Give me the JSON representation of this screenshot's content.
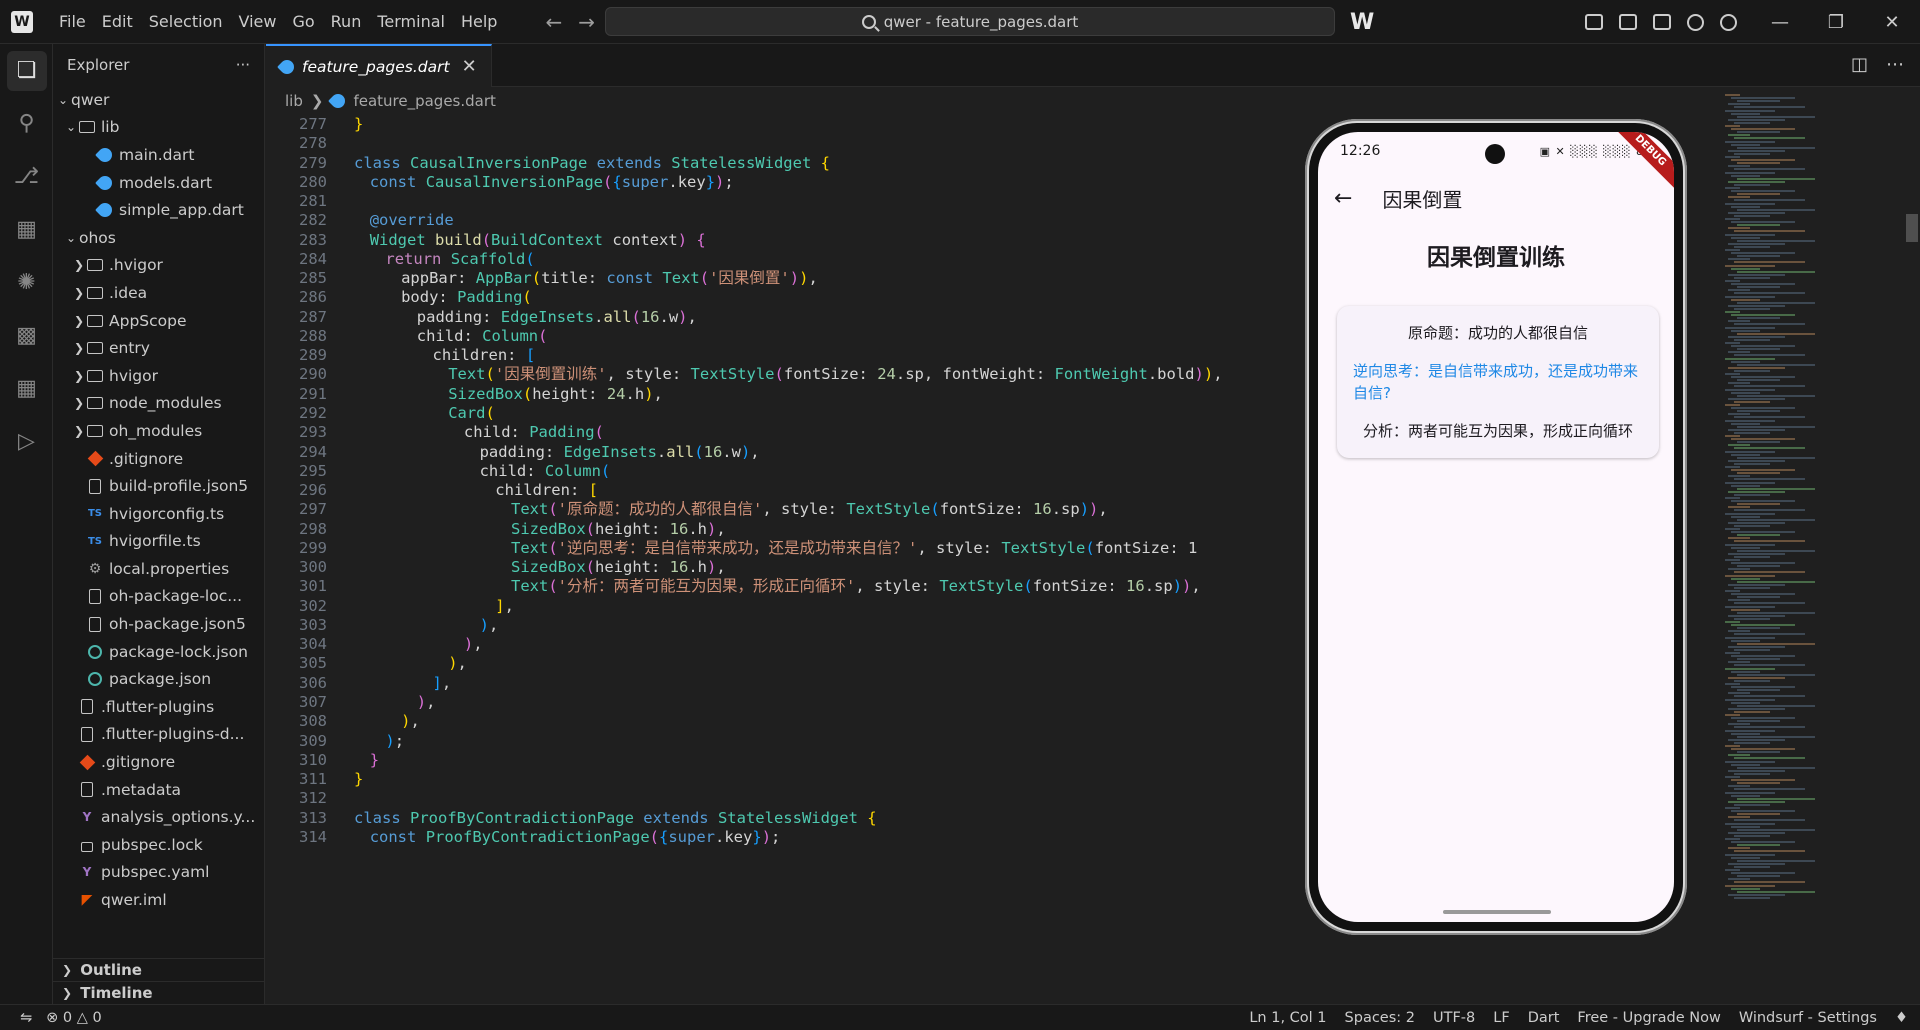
{
  "menu": [
    "File",
    "Edit",
    "Selection",
    "View",
    "Go",
    "Run",
    "Terminal",
    "Help"
  ],
  "command_center": "qwer - feature_pages.dart",
  "sidebar": {
    "title": "Explorer",
    "more": "···",
    "root": "qwer",
    "lib_folder": "lib",
    "lib_files": [
      "main.dart",
      "models.dart",
      "simple_app.dart"
    ],
    "ohos_folder": "ohos",
    "ohos_items": [
      {
        "label": ".hvigor",
        "type": "folder"
      },
      {
        "label": ".idea",
        "type": "folder"
      },
      {
        "label": "AppScope",
        "type": "folder"
      },
      {
        "label": "entry",
        "type": "folder"
      },
      {
        "label": "hvigor",
        "type": "folder"
      },
      {
        "label": "node_modules",
        "type": "folder"
      },
      {
        "label": "oh_modules",
        "type": "folder"
      },
      {
        "label": ".gitignore",
        "type": "git"
      },
      {
        "label": "build-profile.json5",
        "type": "file"
      },
      {
        "label": "hvigorconfig.ts",
        "type": "ts"
      },
      {
        "label": "hvigorfile.ts",
        "type": "ts"
      },
      {
        "label": "local.properties",
        "type": "gear"
      },
      {
        "label": "oh-package-loc...",
        "type": "file"
      },
      {
        "label": "oh-package.json5",
        "type": "file"
      },
      {
        "label": "package-lock.json",
        "type": "json"
      },
      {
        "label": "package.json",
        "type": "json"
      }
    ],
    "root_items": [
      {
        "label": ".flutter-plugins",
        "type": "file"
      },
      {
        "label": ".flutter-plugins-d...",
        "type": "file"
      },
      {
        "label": ".gitignore",
        "type": "git"
      },
      {
        "label": ".metadata",
        "type": "file"
      },
      {
        "label": "analysis_options.y...",
        "type": "yaml"
      },
      {
        "label": "pubspec.lock",
        "type": "lock"
      },
      {
        "label": "pubspec.yaml",
        "type": "yaml"
      },
      {
        "label": "qwer.iml",
        "type": "rss"
      }
    ],
    "outline": "Outline",
    "timeline": "Timeline"
  },
  "tab": {
    "label": "feature_pages.dart",
    "close": "✕"
  },
  "breadcrumb": {
    "folder": "lib",
    "file": "feature_pages.dart"
  },
  "code_lines": [
    {
      "n": "277",
      "indent": 0,
      "tokens": [
        [
          "br1",
          "}"
        ]
      ]
    },
    {
      "n": "278",
      "indent": 0,
      "tokens": []
    },
    {
      "n": "279",
      "indent": 0,
      "tokens": [
        [
          "kw",
          "class "
        ],
        [
          "cls",
          "CausalInversionPage "
        ],
        [
          "kw",
          "extends "
        ],
        [
          "cls",
          "StatelessWidget "
        ],
        [
          "br1",
          "{"
        ]
      ]
    },
    {
      "n": "280",
      "indent": 1,
      "tokens": [
        [
          "kw",
          "const "
        ],
        [
          "cls",
          "CausalInversionPage"
        ],
        [
          "br2",
          "("
        ],
        [
          "br3",
          "{"
        ],
        [
          "kw",
          "super"
        ],
        [
          "prop",
          ".key"
        ],
        [
          "br3",
          "}"
        ],
        [
          "br2",
          ")"
        ],
        [
          "prop",
          ";"
        ]
      ]
    },
    {
      "n": "281",
      "indent": 0,
      "tokens": []
    },
    {
      "n": "282",
      "indent": 1,
      "tokens": [
        [
          "ann",
          "@override"
        ]
      ]
    },
    {
      "n": "283",
      "indent": 1,
      "tokens": [
        [
          "cls",
          "Widget "
        ],
        [
          "fn",
          "build"
        ],
        [
          "br2",
          "("
        ],
        [
          "cls",
          "BuildContext "
        ],
        [
          "prop",
          "context"
        ],
        [
          "br2",
          ") "
        ],
        [
          "br2",
          "{"
        ]
      ]
    },
    {
      "n": "284",
      "indent": 2,
      "tokens": [
        [
          "ctrl",
          "return "
        ],
        [
          "cls",
          "Scaffold"
        ],
        [
          "br3",
          "("
        ]
      ]
    },
    {
      "n": "285",
      "indent": 3,
      "tokens": [
        [
          "prop",
          "appBar: "
        ],
        [
          "cls",
          "AppBar"
        ],
        [
          "br1",
          "("
        ],
        [
          "prop",
          "title: "
        ],
        [
          "kw",
          "const "
        ],
        [
          "cls",
          "Text"
        ],
        [
          "br2",
          "("
        ],
        [
          "str",
          "'因果倒置'"
        ],
        [
          "br2",
          ")"
        ],
        [
          "br1",
          ")"
        ],
        [
          "prop",
          ","
        ]
      ]
    },
    {
      "n": "286",
      "indent": 3,
      "tokens": [
        [
          "prop",
          "body: "
        ],
        [
          "cls",
          "Padding"
        ],
        [
          "br1",
          "("
        ]
      ]
    },
    {
      "n": "287",
      "indent": 4,
      "tokens": [
        [
          "prop",
          "padding: "
        ],
        [
          "cls",
          "EdgeInsets"
        ],
        [
          "prop",
          "."
        ],
        [
          "fn",
          "all"
        ],
        [
          "br2",
          "("
        ],
        [
          "num",
          "16"
        ],
        [
          "prop",
          ".w"
        ],
        [
          "br2",
          ")"
        ],
        [
          "prop",
          ","
        ]
      ]
    },
    {
      "n": "288",
      "indent": 4,
      "tokens": [
        [
          "prop",
          "child: "
        ],
        [
          "cls",
          "Column"
        ],
        [
          "br2",
          "("
        ]
      ]
    },
    {
      "n": "289",
      "indent": 5,
      "tokens": [
        [
          "prop",
          "children: "
        ],
        [
          "br3",
          "["
        ]
      ]
    },
    {
      "n": "290",
      "indent": 6,
      "tokens": [
        [
          "cls",
          "Text"
        ],
        [
          "br1",
          "("
        ],
        [
          "str",
          "'因果倒置训练'"
        ],
        [
          "prop",
          ", style: "
        ],
        [
          "cls",
          "TextStyle"
        ],
        [
          "br2",
          "("
        ],
        [
          "prop",
          "fontSize: "
        ],
        [
          "num",
          "24"
        ],
        [
          "prop",
          ".sp, fontWeight: "
        ],
        [
          "cls",
          "FontWeight"
        ],
        [
          "prop",
          ".bold"
        ],
        [
          "br2",
          ")"
        ],
        [
          "br1",
          ")"
        ],
        [
          "prop",
          ","
        ]
      ]
    },
    {
      "n": "291",
      "indent": 6,
      "tokens": [
        [
          "cls",
          "SizedBox"
        ],
        [
          "br1",
          "("
        ],
        [
          "prop",
          "height: "
        ],
        [
          "num",
          "24"
        ],
        [
          "prop",
          ".h"
        ],
        [
          "br1",
          ")"
        ],
        [
          "prop",
          ","
        ]
      ]
    },
    {
      "n": "292",
      "indent": 6,
      "tokens": [
        [
          "cls",
          "Card"
        ],
        [
          "br1",
          "("
        ]
      ]
    },
    {
      "n": "293",
      "indent": 7,
      "tokens": [
        [
          "prop",
          "child: "
        ],
        [
          "cls",
          "Padding"
        ],
        [
          "br2",
          "("
        ]
      ]
    },
    {
      "n": "294",
      "indent": 8,
      "tokens": [
        [
          "prop",
          "padding: "
        ],
        [
          "cls",
          "EdgeInsets"
        ],
        [
          "prop",
          "."
        ],
        [
          "fn",
          "all"
        ],
        [
          "br3",
          "("
        ],
        [
          "num",
          "16"
        ],
        [
          "prop",
          ".w"
        ],
        [
          "br3",
          ")"
        ],
        [
          "prop",
          ","
        ]
      ]
    },
    {
      "n": "295",
      "indent": 8,
      "tokens": [
        [
          "prop",
          "child: "
        ],
        [
          "cls",
          "Column"
        ],
        [
          "br3",
          "("
        ]
      ]
    },
    {
      "n": "296",
      "indent": 9,
      "tokens": [
        [
          "prop",
          "children: "
        ],
        [
          "br1",
          "["
        ]
      ]
    },
    {
      "n": "297",
      "indent": 10,
      "tokens": [
        [
          "cls",
          "Text"
        ],
        [
          "br2",
          "("
        ],
        [
          "str",
          "'原命题：成功的人都很自信'"
        ],
        [
          "prop",
          ", style: "
        ],
        [
          "cls",
          "TextStyle"
        ],
        [
          "br3",
          "("
        ],
        [
          "prop",
          "fontSize: "
        ],
        [
          "num",
          "16"
        ],
        [
          "prop",
          ".sp"
        ],
        [
          "br3",
          ")"
        ],
        [
          "br2",
          ")"
        ],
        [
          "prop",
          ","
        ]
      ]
    },
    {
      "n": "298",
      "indent": 10,
      "tokens": [
        [
          "cls",
          "SizedBox"
        ],
        [
          "br2",
          "("
        ],
        [
          "prop",
          "height: "
        ],
        [
          "num",
          "16"
        ],
        [
          "prop",
          ".h"
        ],
        [
          "br2",
          ")"
        ],
        [
          "prop",
          ","
        ]
      ]
    },
    {
      "n": "299",
      "indent": 10,
      "tokens": [
        [
          "cls",
          "Text"
        ],
        [
          "br2",
          "("
        ],
        [
          "str",
          "'逆向思考：是自信带来成功，还是成功带来自信？'"
        ],
        [
          "prop",
          ", style: "
        ],
        [
          "cls",
          "TextStyle"
        ],
        [
          "br3",
          "("
        ],
        [
          "prop",
          "fontSize: 1"
        ]
      ]
    },
    {
      "n": "300",
      "indent": 10,
      "tokens": [
        [
          "cls",
          "SizedBox"
        ],
        [
          "br2",
          "("
        ],
        [
          "prop",
          "height: "
        ],
        [
          "num",
          "16"
        ],
        [
          "prop",
          ".h"
        ],
        [
          "br2",
          ")"
        ],
        [
          "prop",
          ","
        ]
      ]
    },
    {
      "n": "301",
      "indent": 10,
      "tokens": [
        [
          "cls",
          "Text"
        ],
        [
          "br2",
          "("
        ],
        [
          "str",
          "'分析：两者可能互为因果，形成正向循环'"
        ],
        [
          "prop",
          ", style: "
        ],
        [
          "cls",
          "TextStyle"
        ],
        [
          "br3",
          "("
        ],
        [
          "prop",
          "fontSize: "
        ],
        [
          "num",
          "16"
        ],
        [
          "prop",
          ".sp"
        ],
        [
          "br3",
          ")"
        ],
        [
          "br2",
          ")"
        ],
        [
          "prop",
          ","
        ]
      ]
    },
    {
      "n": "302",
      "indent": 9,
      "tokens": [
        [
          "br1",
          "]"
        ],
        [
          "prop",
          ","
        ]
      ]
    },
    {
      "n": "303",
      "indent": 8,
      "tokens": [
        [
          "br3",
          ")"
        ],
        [
          "prop",
          ","
        ]
      ]
    },
    {
      "n": "304",
      "indent": 7,
      "tokens": [
        [
          "br2",
          ")"
        ],
        [
          "prop",
          ","
        ]
      ]
    },
    {
      "n": "305",
      "indent": 6,
      "tokens": [
        [
          "br1",
          ")"
        ],
        [
          "prop",
          ","
        ]
      ]
    },
    {
      "n": "306",
      "indent": 5,
      "tokens": [
        [
          "br3",
          "]"
        ],
        [
          "prop",
          ","
        ]
      ]
    },
    {
      "n": "307",
      "indent": 4,
      "tokens": [
        [
          "br2",
          ")"
        ],
        [
          "prop",
          ","
        ]
      ]
    },
    {
      "n": "308",
      "indent": 3,
      "tokens": [
        [
          "br1",
          ")"
        ],
        [
          "prop",
          ","
        ]
      ]
    },
    {
      "n": "309",
      "indent": 2,
      "tokens": [
        [
          "br3",
          ")"
        ],
        [
          "prop",
          ";"
        ]
      ]
    },
    {
      "n": "310",
      "indent": 1,
      "tokens": [
        [
          "br2",
          "}"
        ]
      ]
    },
    {
      "n": "311",
      "indent": 0,
      "tokens": [
        [
          "br1",
          "}"
        ]
      ]
    },
    {
      "n": "312",
      "indent": 0,
      "tokens": []
    },
    {
      "n": "313",
      "indent": 0,
      "tokens": [
        [
          "kw",
          "class "
        ],
        [
          "cls",
          "ProofByContradictionPage "
        ],
        [
          "kw",
          "extends "
        ],
        [
          "cls",
          "StatelessWidget "
        ],
        [
          "br1",
          "{"
        ]
      ]
    },
    {
      "n": "314",
      "indent": 1,
      "tokens": [
        [
          "kw",
          "const "
        ],
        [
          "cls",
          "ProofByContradictionPage"
        ],
        [
          "br2",
          "("
        ],
        [
          "br3",
          "{"
        ],
        [
          "kw",
          "super"
        ],
        [
          "prop",
          ".key"
        ],
        [
          "br3",
          "}"
        ],
        [
          "br2",
          ")"
        ],
        [
          "prop",
          ";"
        ]
      ]
    }
  ],
  "phone": {
    "time": "12:26",
    "status_icons": "▣ ✕ ░░░ ░░░ 86",
    "debug": "DEBUG",
    "back": "←",
    "appbar_title": "因果倒置",
    "heading": "因果倒置训练",
    "premise": "原命题：成功的人都很自信",
    "reverse": "逆向思考：是自信带来成功，还是成功带来自信?",
    "analysis": "分析：两者可能互为因果，形成正向循环"
  },
  "statusbar": {
    "errors": "0",
    "warnings": "0",
    "position": "Ln 1, Col 1",
    "spaces": "Spaces: 2",
    "encoding": "UTF-8",
    "eol": "LF",
    "language": "Dart",
    "upgrade": "Free - Upgrade Now",
    "settings": "Windsurf - Settings"
  },
  "colors": {
    "accent": "#3794ff",
    "editor_bg": "#1f1f1f",
    "sidebar_bg": "#181818",
    "link_blue": "#1e88e5"
  }
}
